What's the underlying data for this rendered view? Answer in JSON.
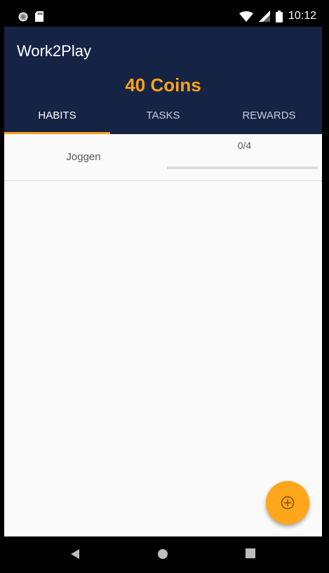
{
  "status_bar": {
    "time": "10:12",
    "icons": [
      "circle-indicator-icon",
      "sd-card-icon",
      "wifi-icon",
      "signal-icon",
      "battery-icon"
    ]
  },
  "header": {
    "title": "Work2Play",
    "coins": "40 Coins"
  },
  "tabs": [
    {
      "label": "HABITS",
      "active": true
    },
    {
      "label": "TASKS",
      "active": false
    },
    {
      "label": "REWARDS",
      "active": false
    }
  ],
  "habits": [
    {
      "name": "Joggen",
      "progress_text": "0/4",
      "progress_fraction": 0
    }
  ],
  "fab": {
    "icon": "add-circle-icon"
  },
  "nav_bar": {
    "icons": [
      "back-icon",
      "home-icon",
      "recents-icon"
    ]
  },
  "colors": {
    "header_bg": "#152344",
    "accent": "#ffa21a",
    "background": "#fafafa"
  }
}
